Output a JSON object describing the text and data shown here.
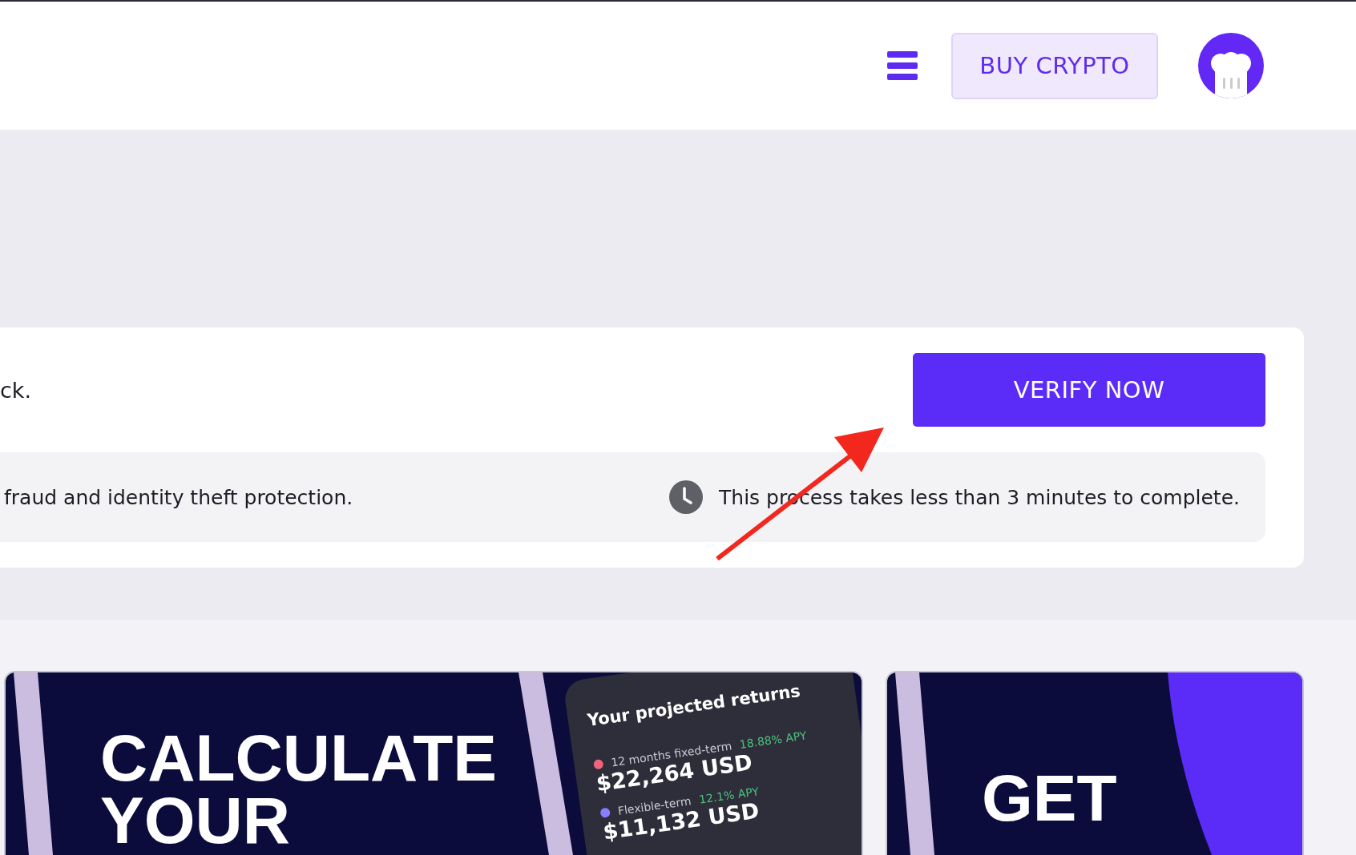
{
  "header": {
    "buy_button": "BUY CRYPTO"
  },
  "verify_card": {
    "message": "ck.",
    "button": "VERIFY NOW",
    "notes": [
      {
        "kind": "plain",
        "text": "fraud and identity theft protection."
      },
      {
        "kind": "clock",
        "text": "This process takes less than 3 minutes to complete."
      }
    ]
  },
  "banners": [
    {
      "kind": "calculator",
      "headline": [
        "CALCULATE",
        "YOUR"
      ],
      "screen": {
        "title": "Your projected returns",
        "rows": [
          {
            "label": "12 months fixed-term",
            "apy": "18.88% APY",
            "amount": "$22,264 USD",
            "color": "#f0637a"
          },
          {
            "label": "Flexible-term",
            "apy": "12.1% APY",
            "amount": "$11,132 USD",
            "color": "#8b7dff"
          }
        ]
      }
    },
    {
      "kind": "accent",
      "headline": [
        "GET"
      ]
    }
  ]
}
